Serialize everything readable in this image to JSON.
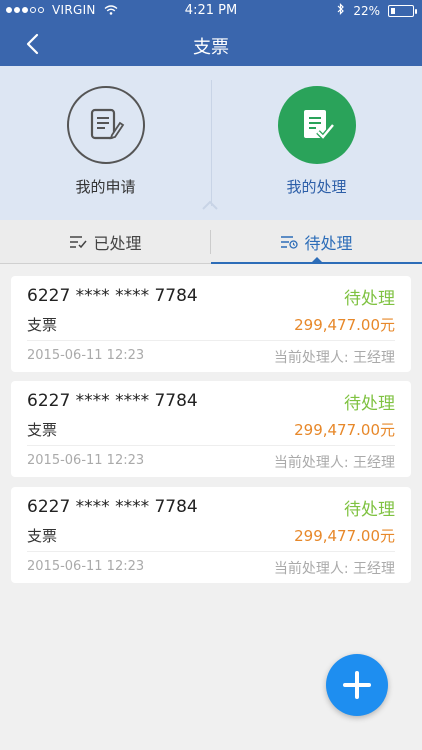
{
  "status_bar": {
    "carrier": "VIRGIN",
    "time": "4:21 PM",
    "battery": "22%",
    "battery_level": 0.22
  },
  "nav": {
    "title": "支票",
    "back_icon": "chevron-left-icon"
  },
  "switch": {
    "items": [
      {
        "label": "我的申请",
        "icon": "document-edit-icon",
        "active": false
      },
      {
        "label": "我的处理",
        "icon": "document-check-icon",
        "active": true
      }
    ]
  },
  "tabs": [
    {
      "label": "已处理",
      "icon": "list-check-icon",
      "active": false
    },
    {
      "label": "待处理",
      "icon": "list-pending-icon",
      "active": true
    }
  ],
  "cards": [
    {
      "number": "6227 **** **** 7784",
      "status": "待处理",
      "type": "支票",
      "amount": "299,477.00元",
      "date": "2015-06-11 12:23",
      "handler": "当前处理人:  王经理"
    },
    {
      "number": "6227 **** **** 7784",
      "status": "待处理",
      "type": "支票",
      "amount": "299,477.00元",
      "date": "2015-06-11 12:23",
      "handler": "当前处理人:  王经理"
    },
    {
      "number": "6227 **** **** 7784",
      "status": "待处理",
      "type": "支票",
      "amount": "299,477.00元",
      "date": "2015-06-11 12:23",
      "handler": "当前处理人:  王经理"
    }
  ],
  "fab": {
    "icon": "plus-icon"
  },
  "colors": {
    "header": "#3a66ad",
    "accent_blue": "#2d6db8",
    "status_green": "#7fc241",
    "amount_orange": "#e7882a",
    "fab_blue": "#1e8ef0"
  }
}
